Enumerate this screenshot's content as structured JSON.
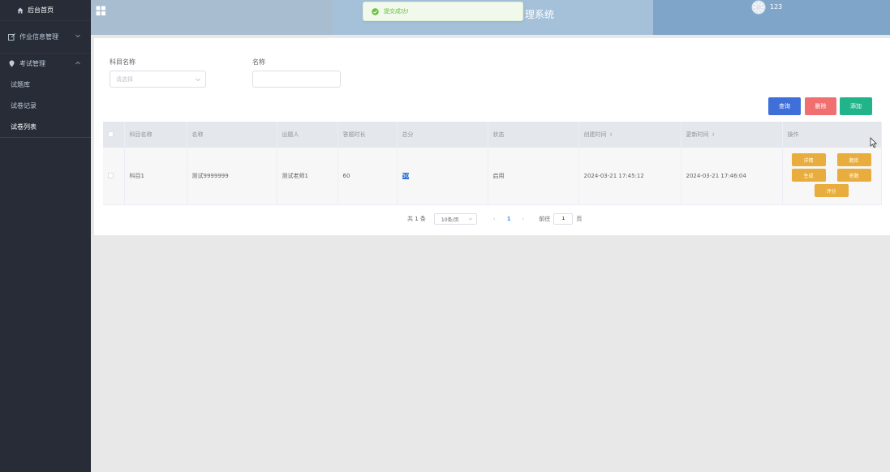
{
  "sidebar": {
    "home": "后台首页",
    "groups": [
      {
        "label": "作业信息管理"
      },
      {
        "label": "考试管理"
      }
    ],
    "sub_items": [
      "试题库",
      "试卷记录",
      "试卷列表"
    ]
  },
  "header": {
    "title": "理系统",
    "user": "123"
  },
  "toast": {
    "message": "提交成功!"
  },
  "filters": {
    "subject_label": "科目名称",
    "subject_placeholder": "请选择",
    "name_label": "名称",
    "name_value": ""
  },
  "buttons": {
    "query": "查询",
    "delete": "删除",
    "add": "添加"
  },
  "table": {
    "columns": [
      "科目名称",
      "名称",
      "出题人",
      "答题时长",
      "总分",
      "状态",
      "创建时间",
      "更新时间",
      "操作"
    ],
    "rows": [
      {
        "subject": "科目1",
        "name": "测试9999999",
        "author": "测试老师1",
        "duration": "60",
        "score": "50",
        "status": "启用",
        "created": "2024-03-21 17:45:12",
        "updated": "2024-03-21 17:46:04"
      }
    ],
    "row_actions": [
      "详情",
      "题库",
      "生成",
      "答题",
      "评分"
    ]
  },
  "pagination": {
    "total": "共 1 条",
    "page_size": "10条/页",
    "current_page": "1",
    "goto_label": "前往",
    "goto_value": "1",
    "page_suffix": "页"
  },
  "colors": {
    "sidebar_bg": "#272c37",
    "header_bg": "#a9bdd0",
    "primary": "#3f6fd9",
    "danger": "#f07070",
    "success": "#21b38a",
    "warning": "#e8ad3c"
  }
}
